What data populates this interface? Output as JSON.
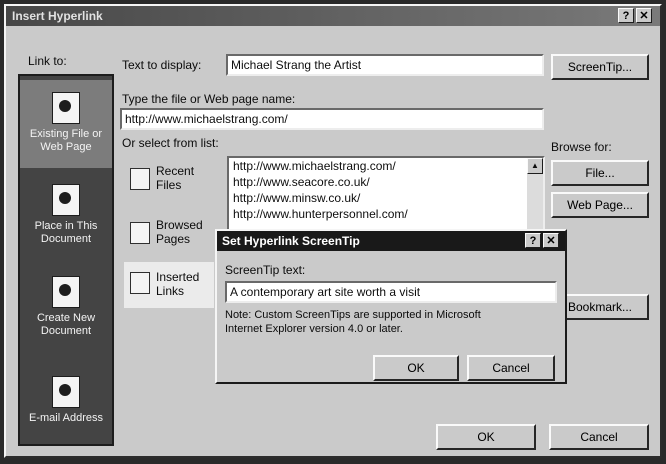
{
  "window": {
    "title": "Insert Hyperlink",
    "help_glyph": "?",
    "close_glyph": "✕"
  },
  "sidebar": {
    "link_to_label": "Link to:",
    "items": [
      {
        "line1": "Existing File or",
        "line2": "Web Page",
        "icon": "web-page-icon"
      },
      {
        "line1": "Place in This",
        "line2": "Document",
        "icon": "document-place-icon"
      },
      {
        "line1": "Create New",
        "line2": "Document",
        "icon": "new-document-icon"
      },
      {
        "line1": "E-mail Address",
        "line2": "",
        "icon": "email-icon"
      }
    ]
  },
  "main": {
    "text_to_display_label": "Text to display:",
    "text_to_display_value": "Michael Strang the Artist",
    "screentip_button": "ScreenTip...",
    "type_file_label": "Type the file or Web page name:",
    "address_value": "http://www.michaelstrang.com/",
    "select_list_label": "Or select from list:",
    "browse_for_label": "Browse for:",
    "file_button": "File...",
    "webpage_button": "Web Page...",
    "bookmark_button": "Bookmark...",
    "ok_button": "OK",
    "cancel_button": "Cancel",
    "list_tabs": [
      {
        "line1": "Recent",
        "line2": "Files"
      },
      {
        "line1": "Browsed",
        "line2": "Pages"
      },
      {
        "line1": "Inserted",
        "line2": "Links"
      }
    ],
    "list_items": [
      "http://www.michaelstrang.com/",
      "http://www.seacore.co.uk/",
      "http://www.minsw.co.uk/",
      "http://www.hunterpersonnel.com/"
    ]
  },
  "dialog": {
    "title": "Set Hyperlink ScreenTip",
    "help_glyph": "?",
    "close_glyph": "✕",
    "screentip_label": "ScreenTip text:",
    "screentip_value": "A contemporary art site worth a visit",
    "note_line1": "Note: Custom ScreenTips are supported in Microsoft",
    "note_line2": "Internet Explorer version 4.0 or later.",
    "ok_button": "OK",
    "cancel_button": "Cancel"
  }
}
